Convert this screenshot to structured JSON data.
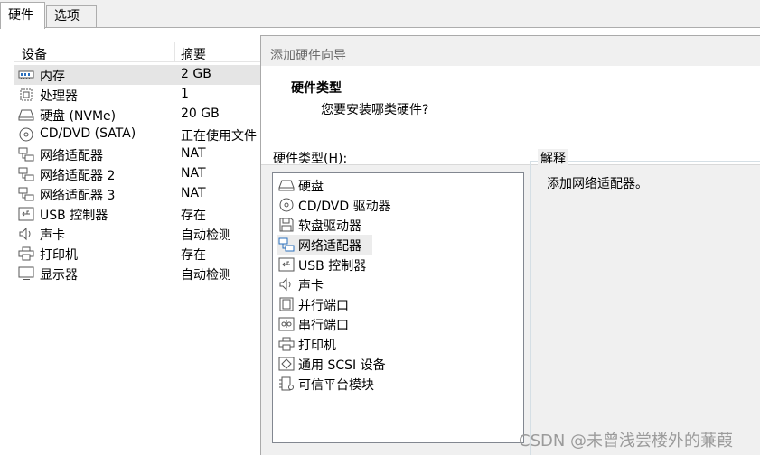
{
  "tabs": [
    {
      "label": "硬件",
      "active": true
    },
    {
      "label": "选项",
      "active": false
    }
  ],
  "device_list": {
    "headers": {
      "device": "设备",
      "summary": "摘要"
    },
    "rows": [
      {
        "icon": "memory-icon",
        "name": "内存",
        "summary": "2 GB",
        "selected": true
      },
      {
        "icon": "processor-icon",
        "name": "处理器",
        "summary": "1"
      },
      {
        "icon": "hard-disk-icon",
        "name": "硬盘 (NVMe)",
        "summary": "20 GB"
      },
      {
        "icon": "cd-dvd-icon",
        "name": "CD/DVD (SATA)",
        "summary": "正在使用文件"
      },
      {
        "icon": "network-adapter-icon",
        "name": "网络适配器",
        "summary": "NAT"
      },
      {
        "icon": "network-adapter-icon",
        "name": "网络适配器 2",
        "summary": "NAT"
      },
      {
        "icon": "network-adapter-icon",
        "name": "网络适配器 3",
        "summary": "NAT"
      },
      {
        "icon": "usb-icon",
        "name": "USB 控制器",
        "summary": "存在"
      },
      {
        "icon": "sound-card-icon",
        "name": "声卡",
        "summary": "自动检测"
      },
      {
        "icon": "printer-icon",
        "name": "打印机",
        "summary": "存在"
      },
      {
        "icon": "display-icon",
        "name": "显示器",
        "summary": "自动检测"
      }
    ]
  },
  "wizard": {
    "title": "添加硬件向导",
    "heading": "硬件类型",
    "subheading": "您要安装哪类硬件?",
    "hardware_type_label": "硬件类型(H):",
    "hardware_types": [
      {
        "icon": "hard-disk-icon",
        "label": "硬盘"
      },
      {
        "icon": "cd-dvd-icon",
        "label": "CD/DVD 驱动器"
      },
      {
        "icon": "floppy-icon",
        "label": "软盘驱动器"
      },
      {
        "icon": "network-adapter-icon",
        "label": "网络适配器",
        "selected": true
      },
      {
        "icon": "usb-icon",
        "label": "USB 控制器"
      },
      {
        "icon": "sound-card-icon",
        "label": "声卡"
      },
      {
        "icon": "parallel-port-icon",
        "label": "并行端口"
      },
      {
        "icon": "serial-port-icon",
        "label": "串行端口"
      },
      {
        "icon": "printer-icon",
        "label": "打印机"
      },
      {
        "icon": "scsi-icon",
        "label": "通用 SCSI 设备"
      },
      {
        "icon": "tpm-icon",
        "label": "可信平台模块"
      }
    ],
    "explanation_label": "解释",
    "explanation_text": "添加网络适配器。"
  },
  "watermark": "CSDN @未曾浅尝楼外的蒹葭",
  "colors": {
    "selection": "#e5e5e5",
    "border": "#828790",
    "icon_blue": "#2a6fbd"
  }
}
